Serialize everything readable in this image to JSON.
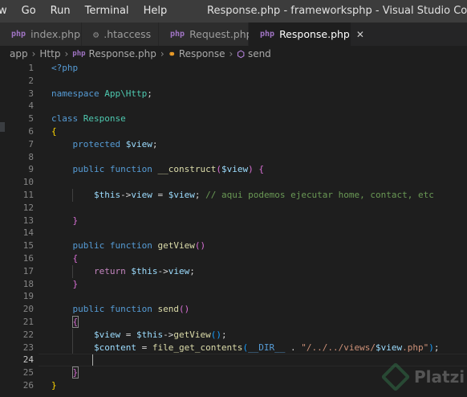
{
  "menu": [
    "w",
    "Go",
    "Run",
    "Terminal",
    "Help"
  ],
  "window_title": "Response.php - frameworksphp - Visual Studio Code",
  "tabs": [
    {
      "label": "index.php",
      "icon": "php-file-icon",
      "active": false
    },
    {
      "label": ".htaccess",
      "icon": "gear-icon",
      "active": false
    },
    {
      "label": "Request.php",
      "icon": "php-file-icon",
      "active": false
    },
    {
      "label": "Response.php",
      "icon": "php-file-icon",
      "active": true,
      "close": "✕"
    }
  ],
  "breadcrumb": [
    "app",
    "Http",
    "Response.php",
    "Response",
    "send"
  ],
  "editor": {
    "current_line": 24,
    "lines": [
      {
        "n": "1",
        "code": "<?php"
      },
      {
        "n": "2",
        "code": ""
      },
      {
        "n": "3",
        "code": "namespace App\\Http;"
      },
      {
        "n": "4",
        "code": ""
      },
      {
        "n": "5",
        "code": "class Response"
      },
      {
        "n": "6",
        "code": "{"
      },
      {
        "n": "7",
        "code": "    protected $view;"
      },
      {
        "n": "8",
        "code": ""
      },
      {
        "n": "9",
        "code": "    public function __construct($view) {"
      },
      {
        "n": "10",
        "code": ""
      },
      {
        "n": "11",
        "code": "        $this->view = $view; // aqui podemos ejecutar home, contact, etc"
      },
      {
        "n": "12",
        "code": ""
      },
      {
        "n": "13",
        "code": "    }"
      },
      {
        "n": "14",
        "code": ""
      },
      {
        "n": "15",
        "code": "    public function getView()"
      },
      {
        "n": "16",
        "code": "    {"
      },
      {
        "n": "17",
        "code": "        return $this->view;"
      },
      {
        "n": "18",
        "code": "    }"
      },
      {
        "n": "19",
        "code": ""
      },
      {
        "n": "20",
        "code": "    public function send()"
      },
      {
        "n": "21",
        "code": "    {"
      },
      {
        "n": "22",
        "code": "        $view = $this->getView();"
      },
      {
        "n": "23",
        "code": "        $content = file_get_contents(__DIR__ . \"/../../views/$view.php\");"
      },
      {
        "n": "24",
        "code": ""
      },
      {
        "n": "25",
        "code": "    }"
      },
      {
        "n": "26",
        "code": "}"
      }
    ]
  },
  "watermark": "Platzi"
}
